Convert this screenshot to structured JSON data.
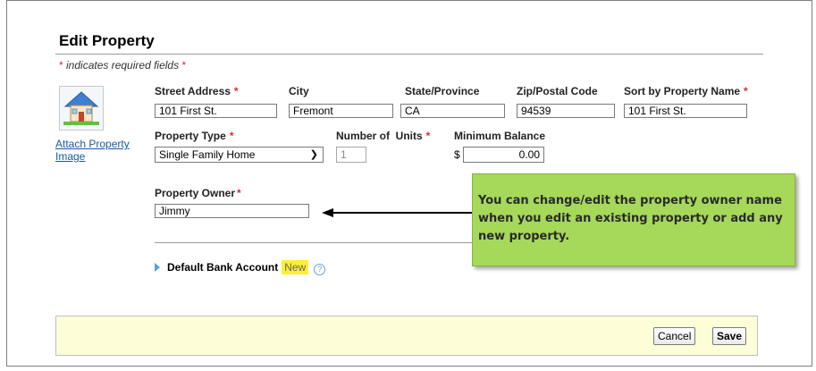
{
  "page": {
    "title": "Edit Property",
    "required_note": "indicates required fields",
    "required_mark": "*"
  },
  "image": {
    "attach_link": "Attach Property Image",
    "icon": "house-icon"
  },
  "fields": {
    "street_address": {
      "label": "Street Address",
      "value": "101 First St."
    },
    "city": {
      "label": "City",
      "value": "Fremont"
    },
    "state": {
      "label": "State/Province",
      "value": "CA"
    },
    "zip": {
      "label": "Zip/Postal Code",
      "value": "94539"
    },
    "sort_name": {
      "label": "Sort by Property Name",
      "value": "101 First St."
    },
    "property_type": {
      "label": "Property Type",
      "value": "Single Family Home"
    },
    "units": {
      "label": "Number of  Units",
      "value": "1"
    },
    "min_balance": {
      "label": "Minimum Balance",
      "currency": "$",
      "value": "0.00"
    },
    "owner": {
      "label": "Property Owner",
      "value": "Jimmy"
    }
  },
  "bank": {
    "label": "Default Bank Account",
    "badge": "New",
    "help": "?"
  },
  "buttons": {
    "cancel": "Cancel",
    "save": "Save"
  },
  "callout": {
    "text": "You can change/edit the property owner name when you edit an existing property or add any new property."
  },
  "colors": {
    "required": "#e0282e",
    "callout_bg": "#a6d85a",
    "footer_bg": "#fdfdd8",
    "link": "#1a5aa0",
    "badge": "#ffef33"
  }
}
